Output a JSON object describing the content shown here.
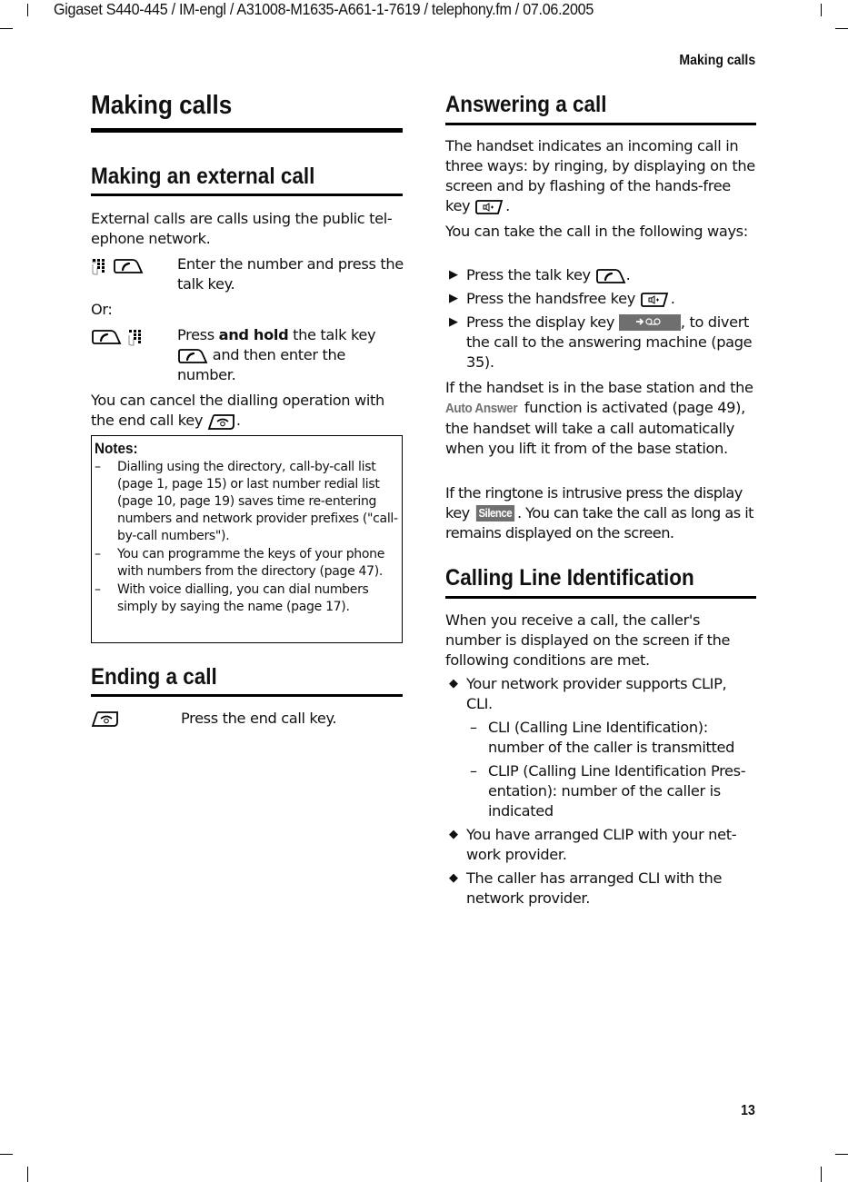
{
  "header": {
    "doc_meta": "Gigaset S440-445 / IM-engl / A31008-M1635-A661-1-7619 / telephony.fm / 07.06.2005",
    "running_head": "Making calls"
  },
  "footer": {
    "page_number": "13"
  },
  "left": {
    "title": "Making calls",
    "external": {
      "heading": "Making an external call",
      "intro": "External calls are calls using the public tel-ephone network.",
      "step1": {
        "icons": [
          "keypad-icon",
          "talk-key-icon"
        ],
        "text": "Enter the number and press the talk key."
      },
      "or_label": "Or:",
      "step2": {
        "icons": [
          "talk-key-icon",
          "keypad-icon"
        ],
        "text_pre": "Press ",
        "text_bold": "and hold",
        "text_mid": " the talk key",
        "text_post": " and then enter the number."
      },
      "cancel_pre": "You can cancel the dialling operation with the end call key ",
      "cancel_post": "."
    },
    "notes": {
      "title": "Notes:",
      "items": [
        "Dialling using the directory, call-by-call list (page 1, page 15) or last number redial list (page 10, page 19) saves time re-entering numbers and network provider prefixes (\"call-by-call numbers\").",
        "You can programme the keys of your phone with numbers from the directory (page 47).",
        "With voice dialling, you can dial numbers simply by saying the name (page 17)."
      ]
    },
    "ending": {
      "heading": "Ending a call",
      "step": {
        "icon": "end-call-key-icon",
        "text": "Press the end call key."
      }
    }
  },
  "right": {
    "answering": {
      "heading": "Answering a call",
      "intro_pre": "The handset indicates an incoming call in three ways: by ringing, by displaying on the screen and by flashing of the hands-free key ",
      "intro_post": ".",
      "ways_intro": "You can take the call in the following ways:",
      "ways": [
        {
          "pre": "Press the talk key ",
          "icon": "talk-key-icon",
          "post": "."
        },
        {
          "pre": "Press the handsfree key ",
          "icon": "handsfree-key-icon",
          "post": "."
        },
        {
          "pre": "Press the display key ",
          "key_label": "➔ω",
          "post": ", to divert the call to the answering machine (page 35)."
        }
      ],
      "auto_pre": "If the handset is in the base station and the ",
      "auto_term": "Auto Answer",
      "auto_post": " function is activated (page 49), the handset will take a call automatically when you lift it from of the base station.",
      "silence_pre": "If the ringtone is intrusive press the display key ",
      "silence_key": "Silence",
      "silence_post": ". You can take the call as long as it remains displayed on the screen."
    },
    "clip": {
      "heading": "Calling Line Identification",
      "intro": "When you receive a call, the caller's number is displayed on the screen if the following conditions are met.",
      "conditions": [
        "Your network provider supports CLIP, CLI.",
        "You have arranged CLIP with your net-work provider.",
        "The caller has arranged CLI with the network provider."
      ],
      "sub_items": [
        "CLI (Calling Line Identification): number of the caller is transmitted",
        "CLIP (Calling Line Identification Pres-entation): number of the caller is indicated"
      ]
    }
  }
}
